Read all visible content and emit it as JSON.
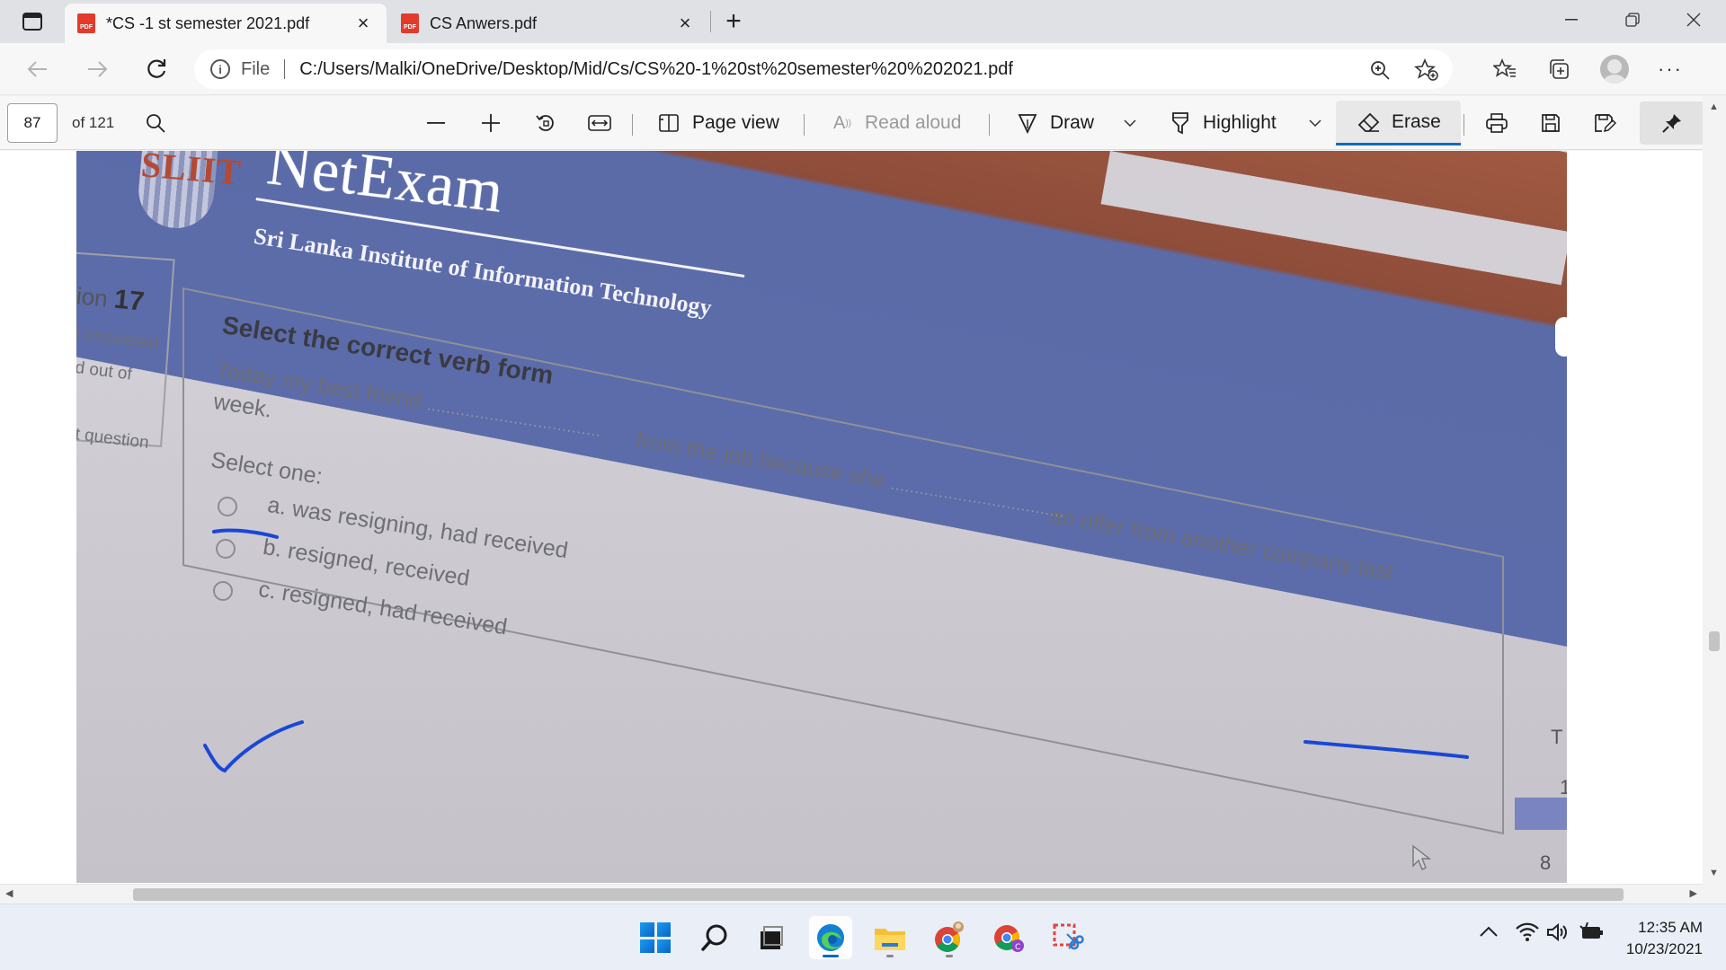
{
  "tabs": [
    {
      "title": "*CS -1 st semester 2021.pdf",
      "icon": "pdf-icon",
      "active": true
    },
    {
      "title": "CS Anwers.pdf",
      "icon": "pdf-icon",
      "active": false
    }
  ],
  "tab_icon_text": "PDF",
  "address": {
    "scheme": "File",
    "url": "C:/Users/Malki/OneDrive/Desktop/Mid/Cs/CS%20-1%20st%20semester%20%202021.pdf"
  },
  "pdf_toolbar": {
    "page_number": "87",
    "page_total": "of 121",
    "page_view": "Page view",
    "read_aloud": "Read aloud",
    "draw": "Draw",
    "highlight": "Highlight",
    "erase": "Erase"
  },
  "document": {
    "logo": "SLIIT",
    "brand": "NetExam",
    "institute": "Sri Lanka Institute of Information Technology",
    "side_panel": {
      "question_label": "ion",
      "question_number": "17",
      "status": "t answered",
      "marks": "d out of",
      "flag": "t question"
    },
    "question": {
      "heading": "Select the correct verb form",
      "text_part1": "Today my best friend",
      "text_part2": "from the job because she",
      "text_part3": "an offer from another company last",
      "text_part4": "week.",
      "blank": "....................................",
      "select_label": "Select one:",
      "options": [
        "a. was resigning, had received",
        "b. resigned, received",
        "c. resigned, had received"
      ]
    },
    "edge_text": [
      "T",
      "1",
      "8"
    ]
  },
  "ink_color": "#1a47d6",
  "taskbar": {
    "apps": [
      "start-icon",
      "search-icon",
      "task-view-icon",
      "edge-icon",
      "file-explorer-icon",
      "chrome-icon",
      "chrome-profile-icon",
      "snipping-tool-icon"
    ],
    "time": "12:35 AM",
    "date": "10/23/2021"
  }
}
